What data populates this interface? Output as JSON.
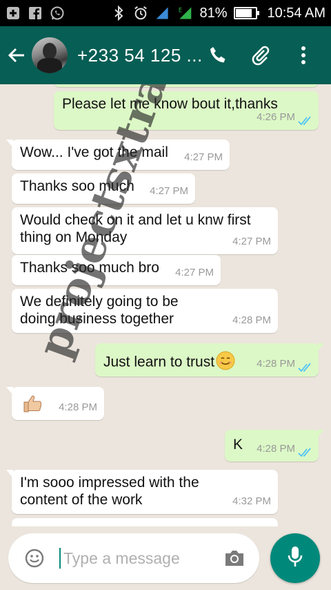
{
  "status_bar": {
    "icons_left": [
      "add-icon",
      "facebook-icon",
      "whatsapp-icon"
    ],
    "battery_percent": 81,
    "battery_text": "81%",
    "time": "10:54 AM"
  },
  "header": {
    "contact_name": "+233 54 125 ...",
    "accent_color": "#075e54"
  },
  "messages": [
    {
      "direction": "out",
      "text": "Please let me know bout it,thanks",
      "time": "4:26 PM",
      "read": true
    },
    {
      "direction": "in",
      "text": "Wow... I've got the mail",
      "time": "4:27 PM"
    },
    {
      "direction": "in",
      "text": "Thanks soo much",
      "time": "4:27 PM"
    },
    {
      "direction": "in",
      "text": "Would check on it and let u knw first thing on Monday",
      "time": "4:27 PM"
    },
    {
      "direction": "in",
      "text": "Thanks soo much bro",
      "time": "4:27 PM"
    },
    {
      "direction": "in",
      "text": "We definitely going to be doing business together",
      "time": "4:28 PM"
    },
    {
      "direction": "out",
      "text": "Just learn to trust",
      "emoji": "smile",
      "time": "4:28 PM",
      "read": true
    },
    {
      "direction": "in",
      "text": "",
      "emoji": "thumbs-up",
      "time": "4:28 PM"
    },
    {
      "direction": "out",
      "text": "K",
      "time": "4:28 PM",
      "read": true
    },
    {
      "direction": "in",
      "text": "I'm sooo impressed with the content of the work",
      "time": "4:32 PM"
    }
  ],
  "input": {
    "placeholder": "Type a message"
  },
  "watermark": "projectsxtra.com"
}
